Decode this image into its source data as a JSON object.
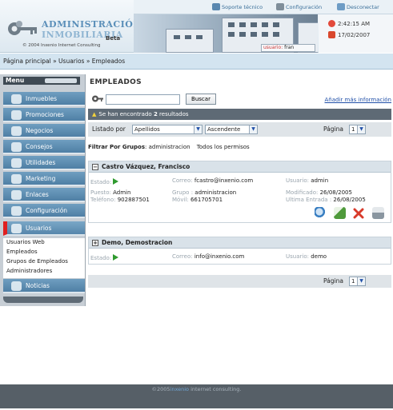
{
  "header": {
    "logo_line1": "ADMINISTRACIÓN",
    "logo_line2": "INMOBILIARIA",
    "logo_beta": "Beta",
    "logo_copyright": "© 2004 Inxenio Internet Consulting",
    "links": [
      {
        "label": "Soporte técnico",
        "icon": "support-icon"
      },
      {
        "label": "Configuración",
        "icon": "config-icon"
      },
      {
        "label": "Desconectar",
        "icon": "disconnect-icon"
      }
    ],
    "usuario_label": "usuario:",
    "usuario_value": "fran",
    "time": "2:42:15 AM",
    "date": "17/02/2007"
  },
  "breadcrumb": {
    "text": "Página principal » Usuarios » Empleados"
  },
  "sidebar": {
    "title": "Menu",
    "items": [
      {
        "label": "Inmuebles",
        "icon": "house-icon"
      },
      {
        "label": "Promociones",
        "icon": "promo-icon"
      },
      {
        "label": "Negocios",
        "icon": "business-icon"
      },
      {
        "label": "Consejos",
        "icon": "tips-icon"
      },
      {
        "label": "Utilidades",
        "icon": "tools-icon"
      },
      {
        "label": "Marketing",
        "icon": "marketing-icon"
      },
      {
        "label": "Enlaces",
        "icon": "links-icon"
      },
      {
        "label": "Configuración",
        "icon": "gear-icon"
      },
      {
        "label": "Usuarios",
        "icon": "users-icon",
        "active": true
      }
    ],
    "subitems": [
      "Usuarios Web",
      "Empleados",
      "Grupos de Empleados",
      "Administradores"
    ],
    "last_item": {
      "label": "Noticias",
      "icon": "news-icon"
    }
  },
  "main": {
    "title": "EMPLEADOS",
    "search": {
      "value": "",
      "button": "Buscar"
    },
    "advanced_link": "Añadir más información",
    "result_prefix": "Se han encontrado ",
    "result_count": "2",
    "result_suffix": " resultados",
    "listado": {
      "label": "Listado por",
      "order_field": "Apellidos",
      "order_dir": "Ascendente",
      "page_label": "Página",
      "page_value": "1"
    },
    "filter": {
      "label": "Filtrar Por Grupos",
      "group": ": administracion",
      "all": "Todos los permisos"
    },
    "employees": [
      {
        "name": "Castro Vázquez, Francisco",
        "estado_label": "Estado:",
        "correo_label": "Correo:",
        "correo": "fcastro@inxenio.com",
        "usuario_label": "Usuario:",
        "usuario": "admin",
        "puesto_label": "Puesto:",
        "puesto": "Admin",
        "grupo_label": "Grupo :",
        "grupo": "administracion",
        "modificado_label": "Modificado:",
        "modificado": "26/08/2005",
        "telefono_label": "Teléfono:",
        "telefono": "902887501",
        "movil_label": "Móvil:",
        "movil": "661705701",
        "ultima_label": "Ultima Entrada :",
        "ultima": "26/08/2005",
        "expanded": true
      },
      {
        "name": "Demo, Demostracion",
        "estado_label": "Estado:",
        "correo_label": "Correo:",
        "correo": "info@inxenio.com",
        "usuario_label": "Usuario:",
        "usuario": "demo",
        "expanded": false
      }
    ],
    "actions": [
      {
        "icon": "search-icon",
        "color": "#3a7fc2"
      },
      {
        "icon": "edit-icon",
        "color": "#4f9a3b"
      },
      {
        "icon": "delete-icon",
        "color": "#d83a2a"
      },
      {
        "icon": "print-icon",
        "color": "#8a96a0"
      }
    ],
    "bottom_pager": {
      "label": "Página",
      "value": "1"
    }
  },
  "footer": {
    "prefix": "©2005",
    "brand": "inxenio",
    "suffix": " internet consulting."
  }
}
